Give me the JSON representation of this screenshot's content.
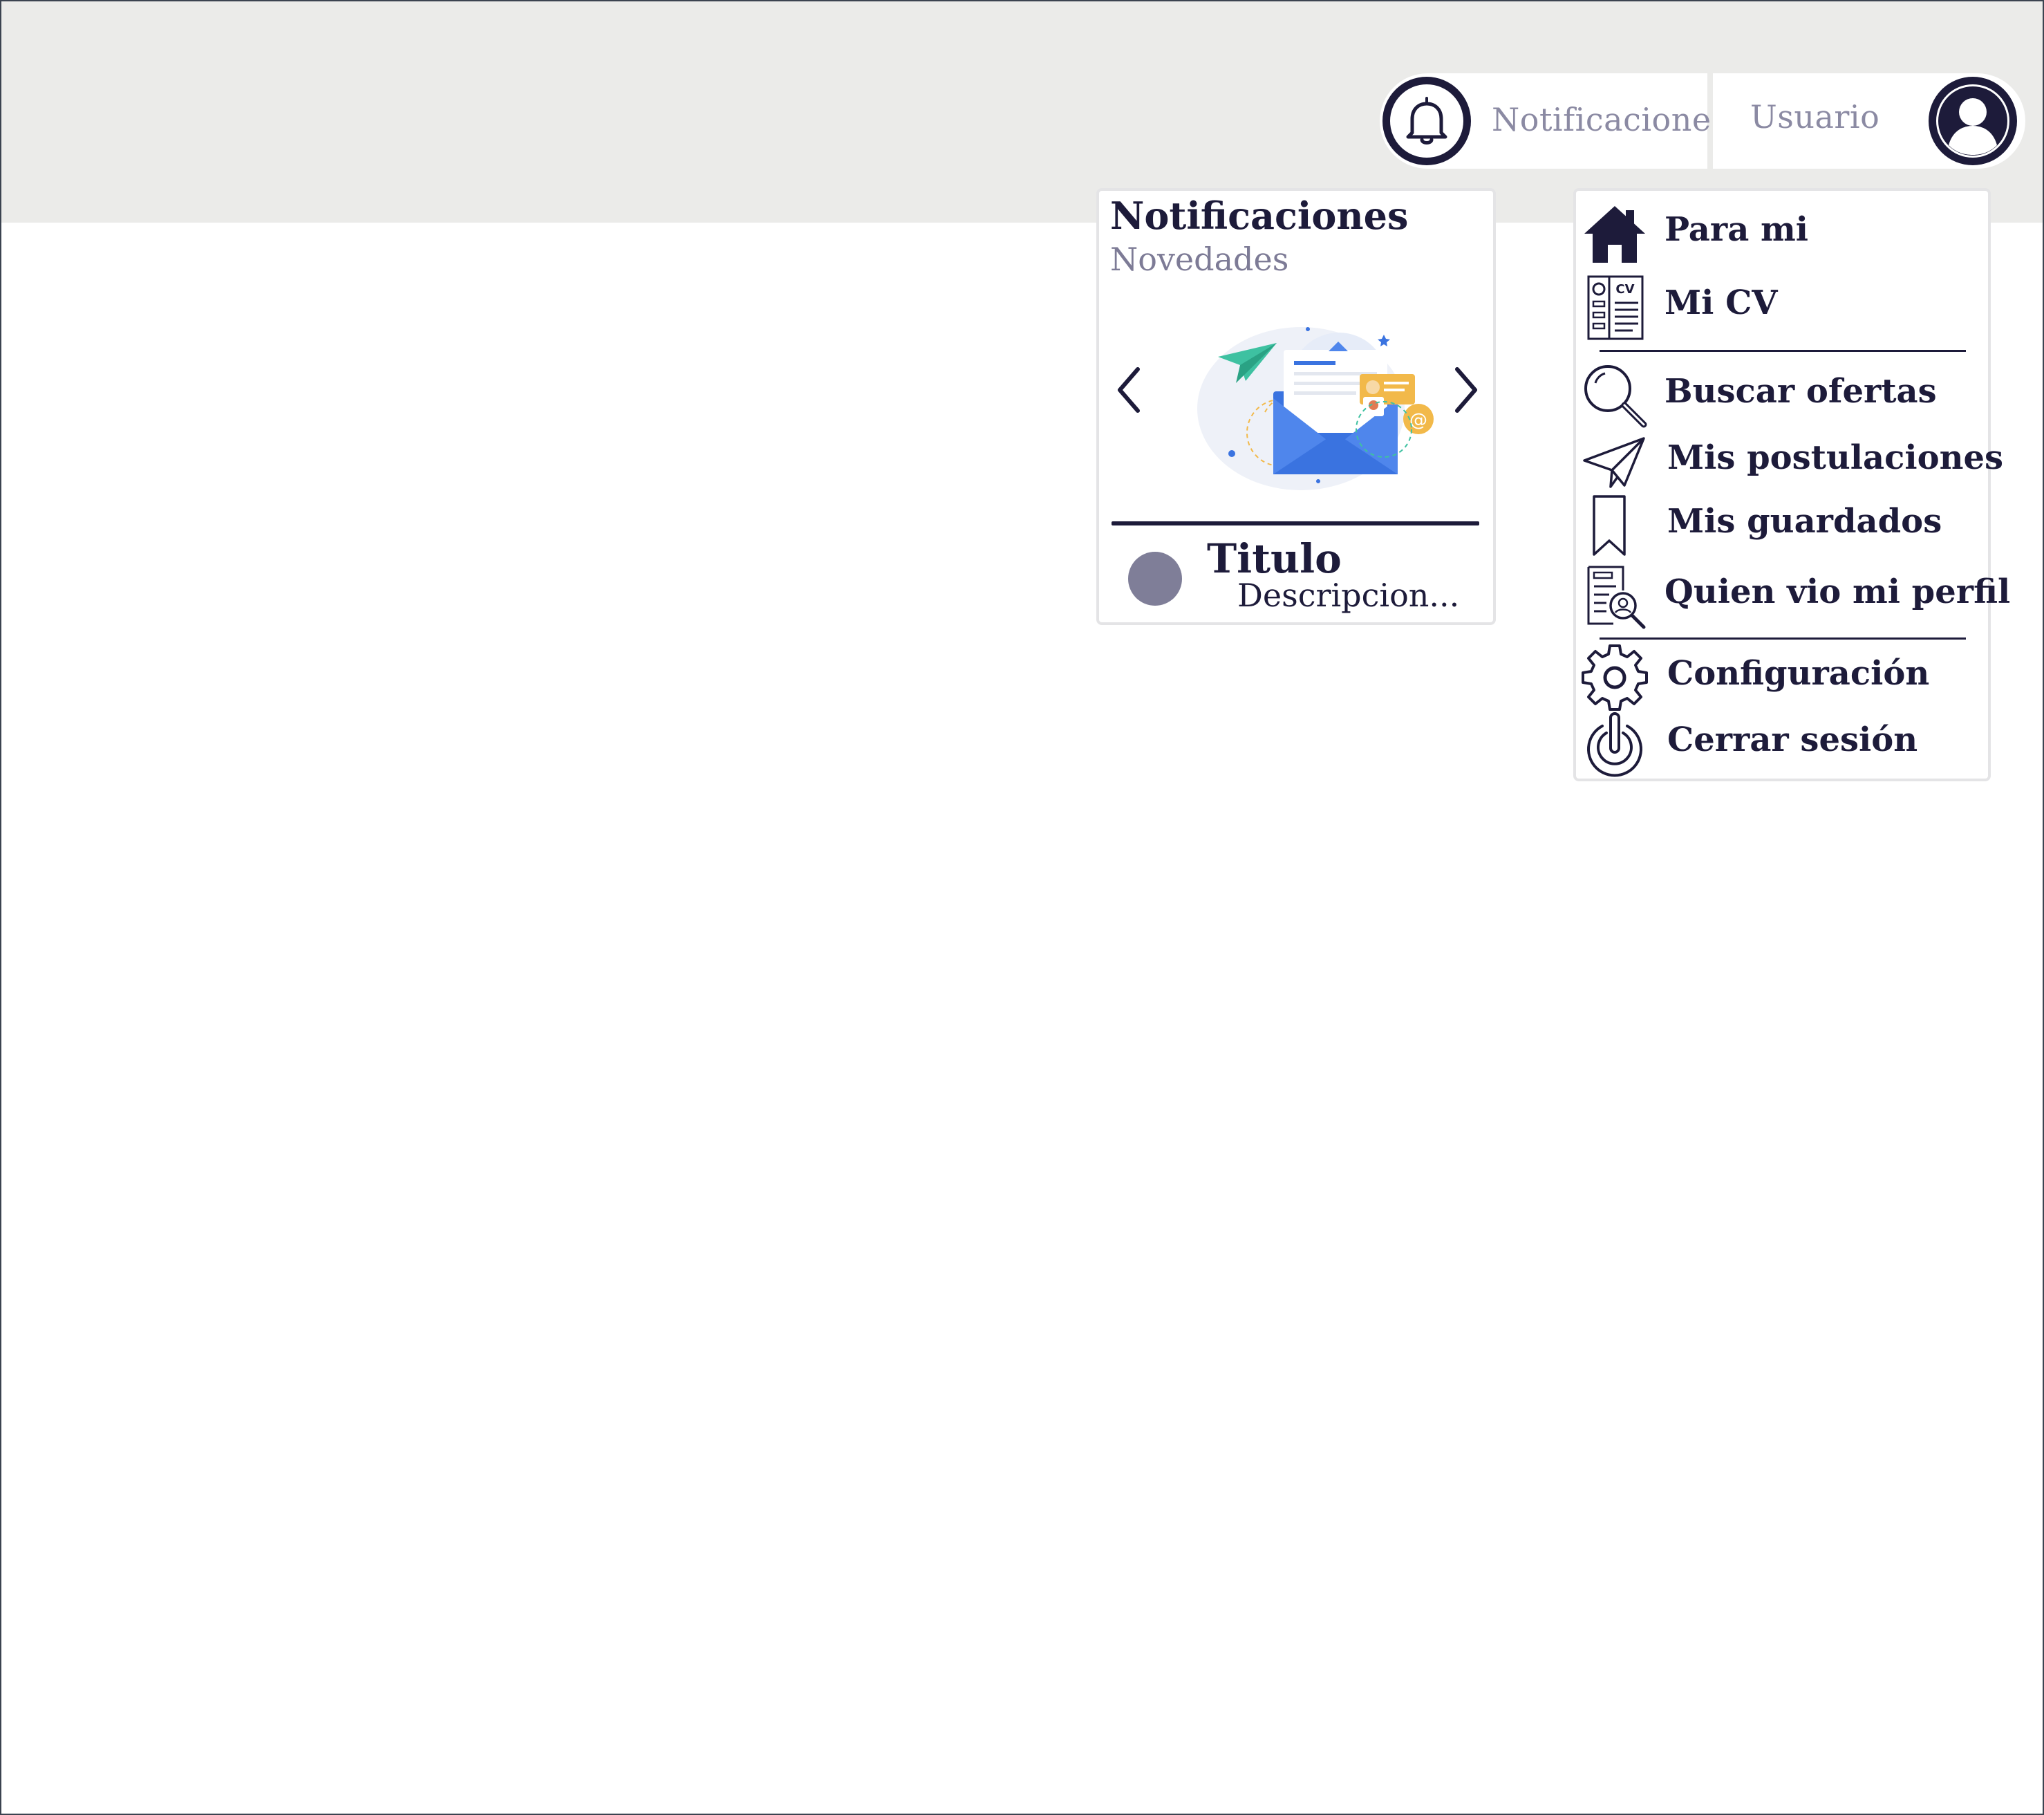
{
  "header": {
    "notifications_label": "Notificaciones",
    "user_label": "Usuario"
  },
  "notifications_panel": {
    "title": "Notificaciones",
    "subtitle": "Novedades",
    "item": {
      "title": "Titulo",
      "description": "Descripcion..."
    }
  },
  "user_menu": {
    "items": [
      {
        "label": "Para mi",
        "icon": "home-icon"
      },
      {
        "label": "Mi CV",
        "icon": "cv-icon"
      },
      {
        "label": "Buscar ofertas",
        "icon": "search-icon"
      },
      {
        "label": "Mis postulaciones",
        "icon": "paper-plane-icon"
      },
      {
        "label": "Mis guardados",
        "icon": "bookmark-icon"
      },
      {
        "label": "Quien vio mi perfil",
        "icon": "profile-viewer-icon"
      },
      {
        "label": "Configuración",
        "icon": "gear-icon"
      },
      {
        "label": "Cerrar sesión",
        "icon": "power-icon"
      }
    ]
  },
  "colors": {
    "primary": "#1d1b3a",
    "muted_text": "#8b8aa3",
    "topbar_bg": "#ebebe9",
    "dot": "#7f7e98"
  }
}
